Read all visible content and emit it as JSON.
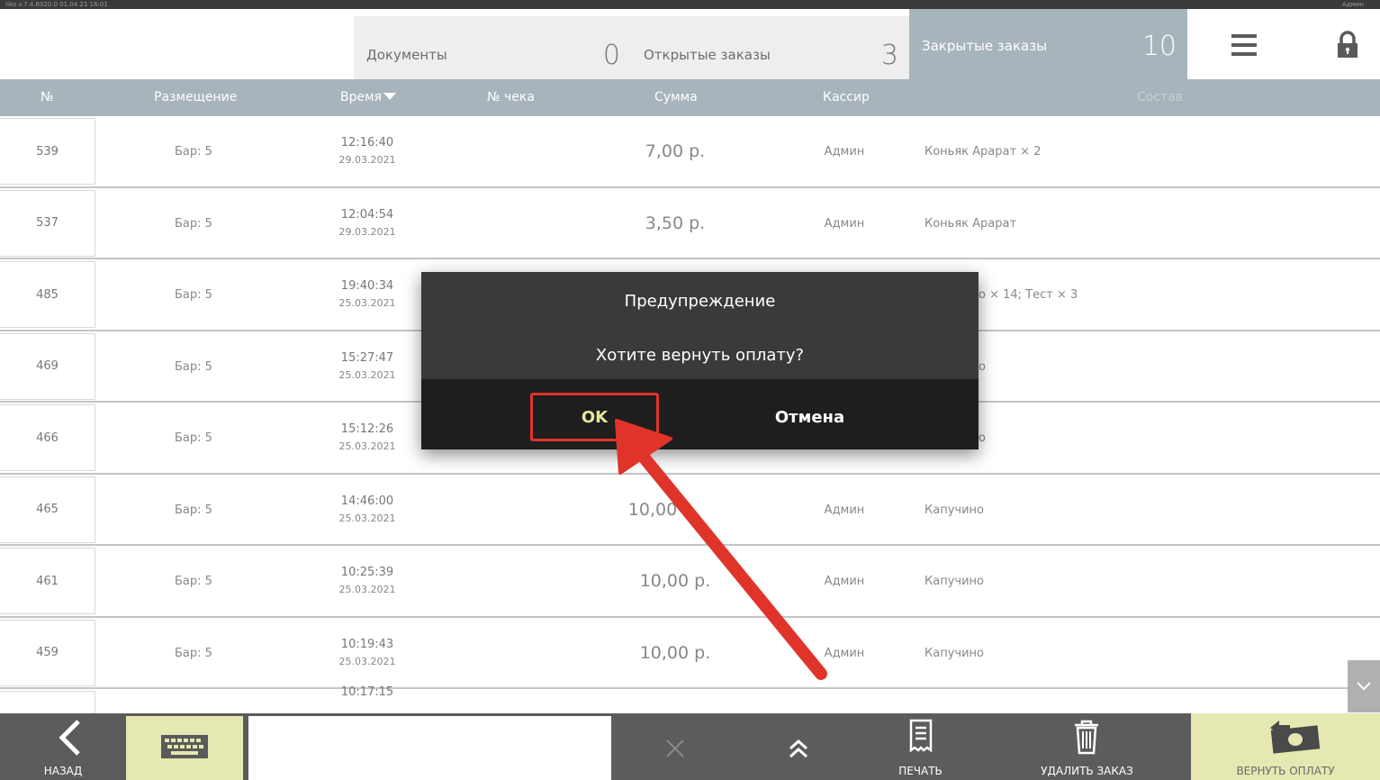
{
  "statusbar": {
    "left": "Iiko v.7.4.6020.0    01.04.21   16:01",
    "right": "Админ"
  },
  "tabs": {
    "docs": {
      "label": "Документы",
      "count": "0"
    },
    "open": {
      "label": "Открытые заказы",
      "count": "3"
    },
    "closed": {
      "label": "Закрытые заказы",
      "count": "10"
    }
  },
  "columns": {
    "num": "№",
    "place": "Размещение",
    "time": "Время",
    "check": "№ чека",
    "sum": "Сумма",
    "cashier": "Кассир",
    "items": "Состав"
  },
  "rows": [
    {
      "num": "539",
      "place": "Бар: 5",
      "time": "12:16:40",
      "date": "29.03.2021",
      "sum": "7,00 р.",
      "cashier": "Админ",
      "items": "Коньяк Арарат × 2"
    },
    {
      "num": "537",
      "place": "Бар: 5",
      "time": "12:04:54",
      "date": "29.03.2021",
      "sum": "3,50 р.",
      "cashier": "Админ",
      "items": "Коньяк Арарат"
    },
    {
      "num": "485",
      "place": "Бар: 5",
      "time": "19:40:34",
      "date": "25.03.2021",
      "sum": "",
      "cashier": "",
      "items": "о × 14; Тест × 3"
    },
    {
      "num": "469",
      "place": "Бар: 5",
      "time": "15:27:47",
      "date": "25.03.2021",
      "sum": "",
      "cashier": "",
      "items": "о"
    },
    {
      "num": "466",
      "place": "Бар: 5",
      "time": "15:12:26",
      "date": "25.03.2021",
      "sum": "",
      "cashier": "",
      "items": "о"
    },
    {
      "num": "465",
      "place": "Бар: 5",
      "time": "14:46:00",
      "date": "25.03.2021",
      "sum": "10,00",
      "cashier": "Админ",
      "items": "Капучино"
    },
    {
      "num": "461",
      "place": "Бар: 5",
      "time": "10:25:39",
      "date": "25.03.2021",
      "sum": "10,00 р.",
      "cashier": "Админ",
      "items": "Капучино"
    },
    {
      "num": "459",
      "place": "Бар: 5",
      "time": "10:19:43",
      "date": "25.03.2021",
      "sum": "10,00 р.",
      "cashier": "Админ",
      "items": "Капучино"
    },
    {
      "num": "",
      "place": "",
      "time": "10:17:15",
      "date": "",
      "sum": "",
      "cashier": "",
      "items": ""
    }
  ],
  "bottombar": {
    "back": "НАЗАД",
    "print": "ПЕЧАТЬ",
    "delete": "УДАЛИТЬ ЗАКАЗ",
    "refund": "ВЕРНУТЬ ОПЛАТУ"
  },
  "dialog": {
    "title": "Предупреждение",
    "message": "Хотите вернуть оплату?",
    "ok": "OK",
    "cancel": "Отмена"
  },
  "colors": {
    "header": "#a7b4bb",
    "accent": "#e5e8b1",
    "bottombar": "#5c5c5c",
    "dialog": "#3a3a3a",
    "highlight": "#e0342b"
  }
}
